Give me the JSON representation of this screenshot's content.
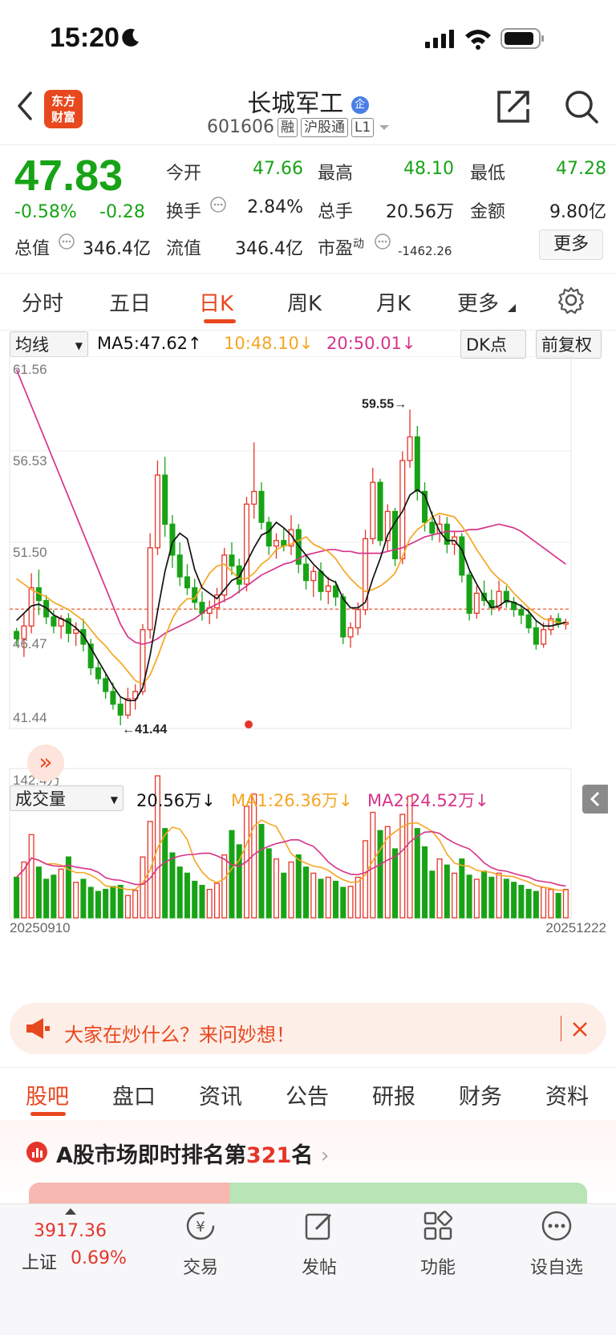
{
  "status": {
    "time": "15:20"
  },
  "header": {
    "logo_line1": "东方",
    "logo_line2": "财富",
    "name": "长城军工",
    "name_badge": "企",
    "code": "601606",
    "tags": [
      "融",
      "沪股通",
      "L1"
    ]
  },
  "quote": {
    "price": "47.83",
    "change_pct": "-0.58%",
    "change": "-0.28",
    "open_label": "今开",
    "open": "47.66",
    "high_label": "最高",
    "high": "48.10",
    "low_label": "最低",
    "low": "47.28",
    "turnover_label": "换手",
    "turnover": "2.84%",
    "total_hands_label": "总手",
    "total_hands": "20.56万",
    "amount_label": "金额",
    "amount": "9.80亿",
    "total_value_label": "总值",
    "total_value": "346.4亿",
    "float_value_label": "流值",
    "float_value": "346.4亿",
    "pe_label": "市盈",
    "pe_sup": "动",
    "pe": "-1462.26",
    "more": "更多"
  },
  "kline_tabs": [
    "分时",
    "五日",
    "日K",
    "周K",
    "月K",
    "更多"
  ],
  "kline_active": 2,
  "ma_row": {
    "selector": "均线",
    "ma5": "MA5:47.62",
    "ma10": "10:48.10",
    "ma20": "20:50.01",
    "dk": "DK点",
    "fq": "前复权"
  },
  "vol_row": {
    "selector": "成交量",
    "vol": "20.56万",
    "ma1": "MA1:26.36万",
    "ma2": "MA2:24.52万"
  },
  "chart_data": {
    "type": "candlestick",
    "y_ticks": [
      "61.56",
      "56.53",
      "51.50",
      "46.47",
      "41.44"
    ],
    "y_range": [
      41.44,
      61.56
    ],
    "high_marker": "59.55",
    "low_marker": "41.44",
    "vol_max_label": "142.4万",
    "x_start": "20250910",
    "x_end": "20251222",
    "ohlc": [
      [
        46.6,
        46.8,
        45.8,
        46.2
      ],
      [
        46.2,
        47.6,
        45.2,
        46.9
      ],
      [
        46.9,
        49.8,
        46.5,
        49.0
      ],
      [
        49.0,
        50.0,
        47.5,
        48.3
      ],
      [
        48.3,
        48.6,
        47.0,
        47.4
      ],
      [
        47.4,
        47.8,
        46.5,
        46.9
      ],
      [
        46.9,
        47.5,
        46.2,
        47.3
      ],
      [
        47.3,
        47.6,
        46.0,
        46.5
      ],
      [
        46.5,
        47.1,
        45.8,
        46.7
      ],
      [
        46.7,
        47.3,
        45.5,
        45.9
      ],
      [
        45.9,
        46.2,
        44.2,
        44.6
      ],
      [
        44.6,
        45.0,
        43.7,
        44.0
      ],
      [
        44.0,
        44.3,
        42.9,
        43.3
      ],
      [
        43.3,
        43.8,
        42.3,
        42.6
      ],
      [
        42.6,
        43.0,
        41.44,
        42.0
      ],
      [
        42.0,
        43.5,
        41.8,
        42.9
      ],
      [
        42.9,
        43.7,
        42.3,
        43.3
      ],
      [
        43.3,
        47.0,
        43.1,
        46.7
      ],
      [
        46.7,
        52.0,
        46.2,
        51.2
      ],
      [
        51.2,
        56.0,
        50.8,
        55.2
      ],
      [
        55.2,
        56.2,
        51.8,
        52.5
      ],
      [
        52.5,
        53.0,
        50.1,
        50.8
      ],
      [
        50.8,
        51.5,
        49.1,
        49.6
      ],
      [
        49.6,
        50.3,
        48.6,
        49.0
      ],
      [
        49.0,
        49.5,
        47.8,
        48.2
      ],
      [
        48.2,
        48.8,
        47.2,
        47.6
      ],
      [
        47.6,
        48.3,
        47.0,
        47.9
      ],
      [
        47.9,
        49.0,
        47.3,
        48.6
      ],
      [
        48.6,
        51.2,
        48.2,
        50.8
      ],
      [
        50.8,
        51.5,
        49.7,
        50.2
      ],
      [
        50.2,
        50.6,
        48.7,
        49.2
      ],
      [
        49.2,
        54.0,
        48.8,
        53.6
      ],
      [
        53.6,
        57.0,
        52.8,
        54.3
      ],
      [
        54.3,
        54.8,
        52.2,
        52.6
      ],
      [
        52.6,
        52.9,
        50.8,
        51.3
      ],
      [
        51.3,
        52.0,
        50.6,
        51.6
      ],
      [
        51.6,
        52.3,
        51.0,
        51.3
      ],
      [
        51.3,
        53.0,
        50.8,
        52.2
      ],
      [
        52.2,
        52.5,
        49.8,
        50.3
      ],
      [
        50.3,
        50.8,
        48.9,
        49.4
      ],
      [
        49.4,
        50.2,
        48.5,
        49.9
      ],
      [
        49.9,
        50.4,
        48.3,
        48.8
      ],
      [
        48.8,
        49.6,
        48.1,
        49.1
      ],
      [
        49.1,
        49.4,
        48.0,
        48.5
      ],
      [
        48.5,
        48.7,
        45.9,
        46.3
      ],
      [
        46.3,
        47.1,
        45.7,
        46.8
      ],
      [
        46.8,
        48.2,
        46.4,
        47.8
      ],
      [
        47.8,
        52.2,
        47.5,
        51.7
      ],
      [
        51.7,
        55.6,
        51.4,
        54.8
      ],
      [
        54.8,
        55.0,
        51.3,
        51.6
      ],
      [
        51.6,
        53.6,
        51.0,
        53.2
      ],
      [
        53.2,
        53.4,
        50.2,
        50.6
      ],
      [
        50.6,
        56.5,
        50.3,
        56.0
      ],
      [
        56.0,
        58.8,
        55.6,
        57.3
      ],
      [
        57.3,
        57.9,
        53.8,
        54.3
      ],
      [
        54.3,
        54.8,
        52.1,
        52.6
      ],
      [
        52.6,
        53.2,
        51.6,
        52.0
      ],
      [
        52.0,
        53.0,
        51.5,
        52.5
      ],
      [
        52.5,
        52.9,
        50.9,
        51.4
      ],
      [
        51.4,
        52.1,
        50.8,
        51.8
      ],
      [
        51.8,
        52.0,
        49.3,
        49.7
      ],
      [
        49.7,
        49.9,
        47.2,
        47.6
      ],
      [
        47.6,
        49.1,
        47.3,
        48.7
      ],
      [
        48.7,
        49.4,
        48.0,
        48.3
      ],
      [
        48.3,
        48.9,
        47.5,
        47.9
      ],
      [
        47.9,
        49.4,
        47.7,
        48.8
      ],
      [
        48.8,
        49.1,
        47.9,
        48.2
      ],
      [
        48.2,
        48.5,
        47.4,
        47.8
      ],
      [
        47.8,
        48.1,
        47.0,
        47.5
      ],
      [
        47.5,
        47.8,
        46.5,
        46.8
      ],
      [
        46.8,
        47.2,
        45.6,
        45.9
      ],
      [
        45.9,
        47.1,
        45.7,
        46.7
      ],
      [
        46.7,
        47.5,
        46.4,
        47.3
      ],
      [
        47.3,
        47.6,
        46.8,
        47.0
      ],
      [
        47.0,
        47.3,
        46.7,
        47.1
      ]
    ],
    "volume": [
      40,
      55,
      82,
      50,
      38,
      42,
      48,
      60,
      35,
      38,
      30,
      26,
      28,
      31,
      32,
      22,
      27,
      60,
      95,
      140,
      88,
      64,
      50,
      44,
      36,
      32,
      28,
      34,
      62,
      86,
      72,
      110,
      122,
      92,
      68,
      58,
      44,
      55,
      62,
      50,
      44,
      38,
      40,
      36,
      30,
      31,
      40,
      76,
      104,
      86,
      90,
      68,
      102,
      120,
      88,
      70,
      46,
      58,
      52,
      44,
      58,
      42,
      38,
      46,
      40,
      44,
      38,
      35,
      32,
      28,
      26,
      30,
      28,
      24,
      28
    ],
    "ma5": [
      47.2,
      47.6,
      48.0,
      48.1,
      47.9,
      47.5,
      47.3,
      47.1,
      46.8,
      46.4,
      45.7,
      45.0,
      44.3,
      43.6,
      43.0,
      42.8,
      42.8,
      43.5,
      45.3,
      47.7,
      49.9,
      51.5,
      52.0,
      51.7,
      50.0,
      49.0,
      48.7,
      48.4,
      48.9,
      49.4,
      49.6,
      50.4,
      51.2,
      51.9,
      52.1,
      52.6,
      52.3,
      51.9,
      51.3,
      50.8,
      50.3,
      49.9,
      49.5,
      49.3,
      48.4,
      47.9,
      47.9,
      48.2,
      49.5,
      50.6,
      51.9,
      52.6,
      53.2,
      54.1,
      54.4,
      54.1,
      53.0,
      52.1,
      51.6,
      51.6,
      51.1,
      50.0,
      49.2,
      48.5,
      47.9,
      48.0,
      48.3,
      48.2,
      48.0,
      47.7,
      47.2,
      46.9,
      46.9,
      47.0,
      47.1
    ],
    "ma10": [
      49.5,
      49.2,
      48.9,
      48.7,
      48.5,
      48.2,
      48.0,
      47.8,
      47.5,
      47.2,
      46.7,
      46.2,
      45.8,
      45.3,
      44.9,
      44.4,
      43.9,
      43.7,
      44.2,
      45.2,
      46.3,
      47.3,
      48.0,
      48.4,
      48.4,
      49.1,
      49.8,
      50.2,
      50.3,
      49.9,
      49.5,
      49.5,
      49.8,
      50.3,
      50.6,
      51.1,
      51.3,
      51.4,
      51.6,
      51.8,
      51.4,
      51.2,
      51.0,
      50.6,
      50.0,
      49.5,
      49.1,
      48.8,
      48.9,
      49.1,
      49.4,
      49.8,
      50.7,
      51.7,
      52.2,
      52.5,
      52.9,
      53.1,
      53.0,
      52.9,
      52.4,
      51.8,
      51.1,
      50.5,
      49.9,
      49.5,
      49.2,
      48.7,
      48.3,
      47.9,
      47.6,
      47.3,
      47.2,
      47.1,
      47.0
    ],
    "ma20": [
      61.0,
      60.0,
      59.0,
      58.0,
      57.0,
      56.0,
      55.0,
      54.0,
      53.0,
      52.0,
      51.0,
      50.0,
      49.0,
      48.0,
      47.0,
      46.3,
      46.0,
      45.9,
      46.0,
      46.2,
      46.5,
      46.7,
      46.9,
      47.1,
      47.3,
      47.6,
      47.9,
      48.1,
      48.3,
      48.5,
      48.8,
      49.1,
      49.4,
      49.7,
      49.9,
      50.1,
      50.3,
      50.4,
      50.6,
      50.8,
      50.9,
      51.0,
      51.1,
      51.1,
      51.0,
      51.0,
      50.9,
      50.9,
      50.9,
      50.9,
      51.0,
      51.1,
      51.2,
      51.4,
      51.6,
      51.8,
      51.9,
      52.0,
      52.1,
      52.1,
      52.1,
      52.2,
      52.2,
      52.3,
      52.4,
      52.5,
      52.4,
      52.3,
      52.1,
      51.8,
      51.5,
      51.2,
      50.9,
      50.6,
      50.3
    ]
  },
  "banner": {
    "text": "大家在炒什么？来问妙想！"
  },
  "bottom_tabs": [
    "股吧",
    "盘口",
    "资讯",
    "公告",
    "研报",
    "财务",
    "资料"
  ],
  "bottom_active": 0,
  "rank": {
    "prefix": "A股市场即时排名第",
    "number": "321",
    "suffix": "名"
  },
  "nav": {
    "index_value": "3917.36",
    "index_name": "上证",
    "index_change": "0.69%",
    "items": [
      "交易",
      "发帖",
      "功能",
      "设自选"
    ]
  },
  "colors": {
    "up": "#e5352a",
    "down": "#18a316",
    "accent": "#e8481e",
    "ma5": "#111111",
    "ma10": "#f5a623",
    "ma20": "#d6348a"
  }
}
